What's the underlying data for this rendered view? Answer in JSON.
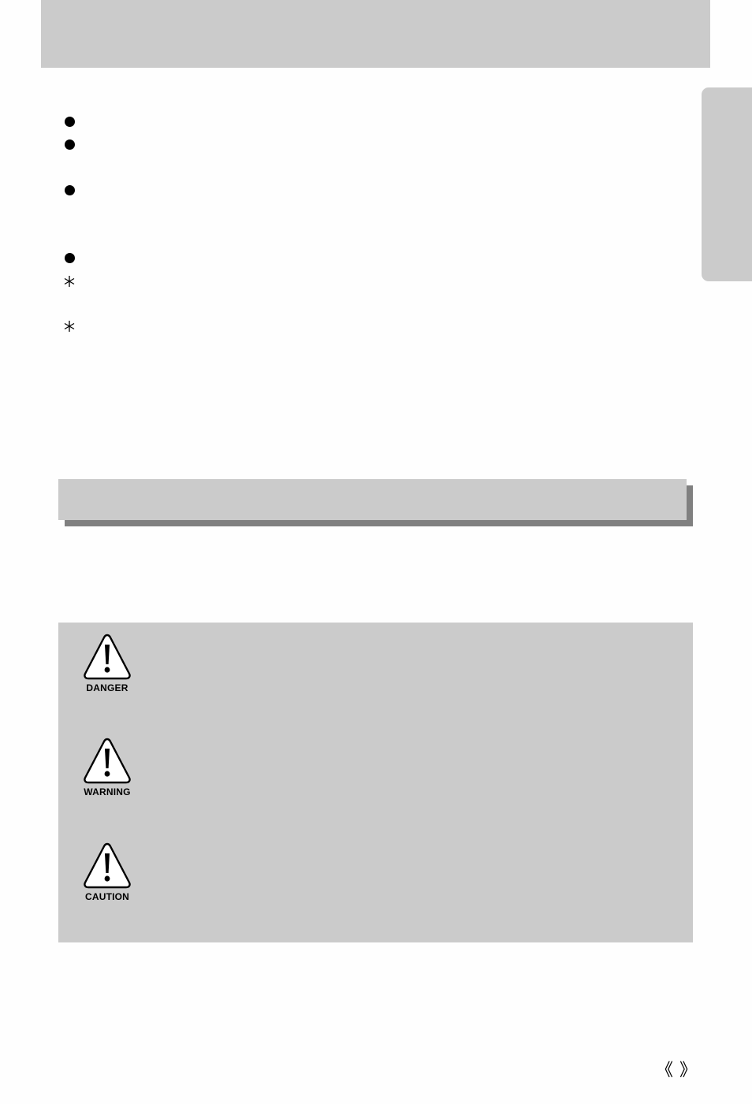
{
  "header": {
    "title": ""
  },
  "side_tab": {
    "label": ""
  },
  "bullets": [
    {
      "marker": "bullet",
      "text": ""
    },
    {
      "marker": "bullet",
      "text": ""
    },
    {
      "marker": "bullet",
      "text": ""
    },
    {
      "marker": "bullet",
      "text": ""
    },
    {
      "marker": "asterisk",
      "text": ""
    },
    {
      "marker": "asterisk",
      "text": ""
    }
  ],
  "section_banner": {
    "title": "",
    "intro": ""
  },
  "hazard_notices": [
    {
      "level": "DANGER",
      "icon": "exclamation-triangle-icon",
      "description": ""
    },
    {
      "level": "WARNING",
      "icon": "exclamation-triangle-icon",
      "description": ""
    },
    {
      "level": "CAUTION",
      "icon": "exclamation-triangle-icon",
      "description": ""
    }
  ],
  "footer": {
    "page_open_bracket": "《",
    "page_number": "",
    "page_close_bracket": "》"
  },
  "colors": {
    "panel_gray": "#cbcbcb",
    "shadow_gray": "#808080",
    "page_background": "#fefefe",
    "ink": "#000000"
  }
}
